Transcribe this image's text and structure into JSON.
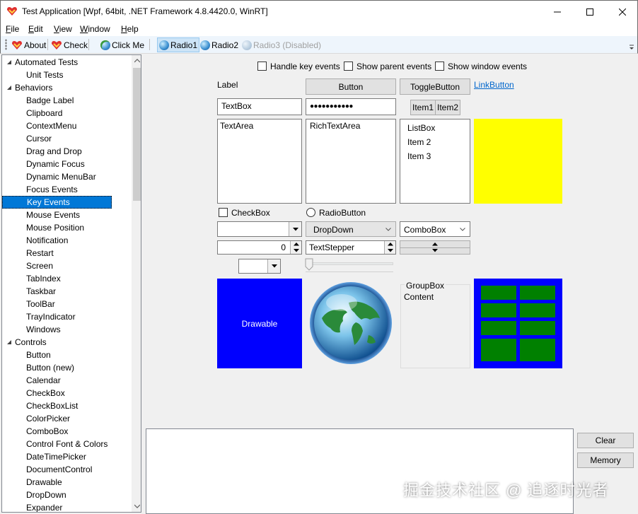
{
  "window": {
    "title": "Test Application [Wpf, 64bit, .NET Framework 4.8.4420.0, WinRT]",
    "buttons": [
      "minimize",
      "maximize",
      "close"
    ]
  },
  "menu": [
    {
      "hot": "F",
      "rest": "ile"
    },
    {
      "hot": "E",
      "rest": "dit"
    },
    {
      "hot": "V",
      "rest": "iew"
    },
    {
      "hot": "W",
      "rest": "indow"
    },
    {
      "hot": "H",
      "rest": "elp"
    }
  ],
  "toolbar": {
    "about": "About",
    "check": "Check",
    "click_me": "Click Me",
    "radio1": "Radio1",
    "radio2": "Radio2",
    "radio3": "Radio3 (Disabled)"
  },
  "tree": [
    {
      "label": "Automated Tests",
      "level": 0,
      "expanded": true
    },
    {
      "label": "Unit Tests",
      "level": 1
    },
    {
      "label": "Behaviors",
      "level": 0,
      "expanded": true
    },
    {
      "label": "Badge Label",
      "level": 1
    },
    {
      "label": "Clipboard",
      "level": 1
    },
    {
      "label": "ContextMenu",
      "level": 1
    },
    {
      "label": "Cursor",
      "level": 1
    },
    {
      "label": "Drag and Drop",
      "level": 1
    },
    {
      "label": "Dynamic Focus",
      "level": 1
    },
    {
      "label": "Dynamic MenuBar",
      "level": 1
    },
    {
      "label": "Focus Events",
      "level": 1
    },
    {
      "label": "Key Events",
      "level": 1,
      "selected": true
    },
    {
      "label": "Mouse Events",
      "level": 1
    },
    {
      "label": "Mouse Position",
      "level": 1
    },
    {
      "label": "Notification",
      "level": 1
    },
    {
      "label": "Restart",
      "level": 1
    },
    {
      "label": "Screen",
      "level": 1
    },
    {
      "label": "TabIndex",
      "level": 1
    },
    {
      "label": "Taskbar",
      "level": 1
    },
    {
      "label": "ToolBar",
      "level": 1
    },
    {
      "label": "TrayIndicator",
      "level": 1
    },
    {
      "label": "Windows",
      "level": 1
    },
    {
      "label": "Controls",
      "level": 0,
      "expanded": true
    },
    {
      "label": "Button",
      "level": 1
    },
    {
      "label": "Button (new)",
      "level": 1
    },
    {
      "label": "Calendar",
      "level": 1
    },
    {
      "label": "CheckBox",
      "level": 1
    },
    {
      "label": "CheckBoxList",
      "level": 1
    },
    {
      "label": "ColorPicker",
      "level": 1
    },
    {
      "label": "ComboBox",
      "level": 1
    },
    {
      "label": "Control Font & Colors",
      "level": 1
    },
    {
      "label": "DateTimePicker",
      "level": 1
    },
    {
      "label": "DocumentControl",
      "level": 1
    },
    {
      "label": "Drawable",
      "level": 1
    },
    {
      "label": "DropDown",
      "level": 1
    },
    {
      "label": "Expander",
      "level": 1
    }
  ],
  "options": {
    "handle_key_events": "Handle key events",
    "show_parent_events": "Show parent events",
    "show_window_events": "Show window events"
  },
  "controls": {
    "label": "Label",
    "button": "Button",
    "toggle_button": "ToggleButton",
    "link_button": "LinkButton",
    "textbox": "TextBox",
    "password": "●●●●●●●●●●●",
    "segment_item1": "Item1",
    "segment_item2": "Item2",
    "textarea": "TextArea",
    "rich_textarea": "RichTextArea",
    "listbox_items": [
      "ListBox",
      "Item 2",
      "Item 3"
    ],
    "checkbox": "CheckBox",
    "radiobutton": "RadioButton",
    "dropdown": "DropDown",
    "combobox": "ComboBox",
    "numeric_value": "0",
    "text_stepper": "TextStepper",
    "drawable": "Drawable",
    "groupbox_title": "GroupBox",
    "groupbox_content": "Content"
  },
  "side_buttons": {
    "clear": "Clear",
    "memory": "Memory"
  },
  "watermark": "掘金技术社区 @ 追逐时光者",
  "colors": {
    "yellow_panel": "#ffff00",
    "drawable": "#0000ff",
    "table_blue": "#0000ff",
    "table_green": "#008000",
    "selection": "#0078d7",
    "link": "#0066cc"
  }
}
